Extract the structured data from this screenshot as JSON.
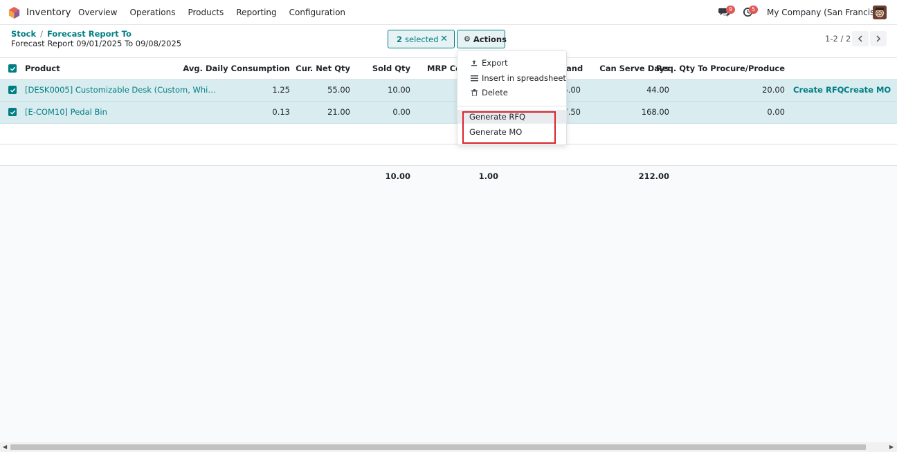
{
  "navbar": {
    "app_name": "Inventory",
    "menu": [
      "Overview",
      "Operations",
      "Products",
      "Reporting",
      "Configuration"
    ],
    "chat_badge": "9",
    "activity_badge": "5",
    "company": "My Company (San Francisco)"
  },
  "control": {
    "breadcrumb": [
      "Stock",
      "Forecast Report To"
    ],
    "breadcrumb_sep": "/",
    "current": "Forecast Report 09/01/2025 To 09/08/2025",
    "selected_count": "2",
    "selected_label": "selected",
    "actions_label": "Actions",
    "pager": "1-2 / 2"
  },
  "table": {
    "headers": {
      "product": "Product",
      "avg_daily": "Avg. Daily Consumption",
      "cur_net": "Cur. Net Qty",
      "sold": "Sold Qty",
      "mrp": "MRP Co",
      "on_hand": "and",
      "can_serve": "Can Serve Days",
      "req_qty": "Req. Qty To Procure/Produce"
    },
    "rows": [
      {
        "product": "[DESK0005] Customizable Desk (Custom, Whi…",
        "avg_daily": "1.25",
        "cur_net": "55.00",
        "sold": "10.00",
        "on_hand": "5.00",
        "can_serve": "44.00",
        "req_qty": "20.00",
        "create_rfq": "Create RFQ",
        "create_mo": "Create MO"
      },
      {
        "product": "[E-COM10] Pedal Bin",
        "avg_daily": "0.13",
        "cur_net": "21.00",
        "sold": "0.00",
        "on_hand": "7.50",
        "can_serve": "168.00",
        "req_qty": "0.00"
      }
    ],
    "totals": {
      "sold": "10.00",
      "mrp": "1.00",
      "can_serve": "212.00"
    }
  },
  "dropdown": {
    "items": [
      "Export",
      "Insert in spreadsheet",
      "Delete"
    ],
    "generate": [
      "Generate RFQ",
      "Generate MO"
    ]
  },
  "colors": {
    "accent": "#017e84",
    "selected_row": "#d9ecef",
    "highlight": "#d9232d"
  }
}
